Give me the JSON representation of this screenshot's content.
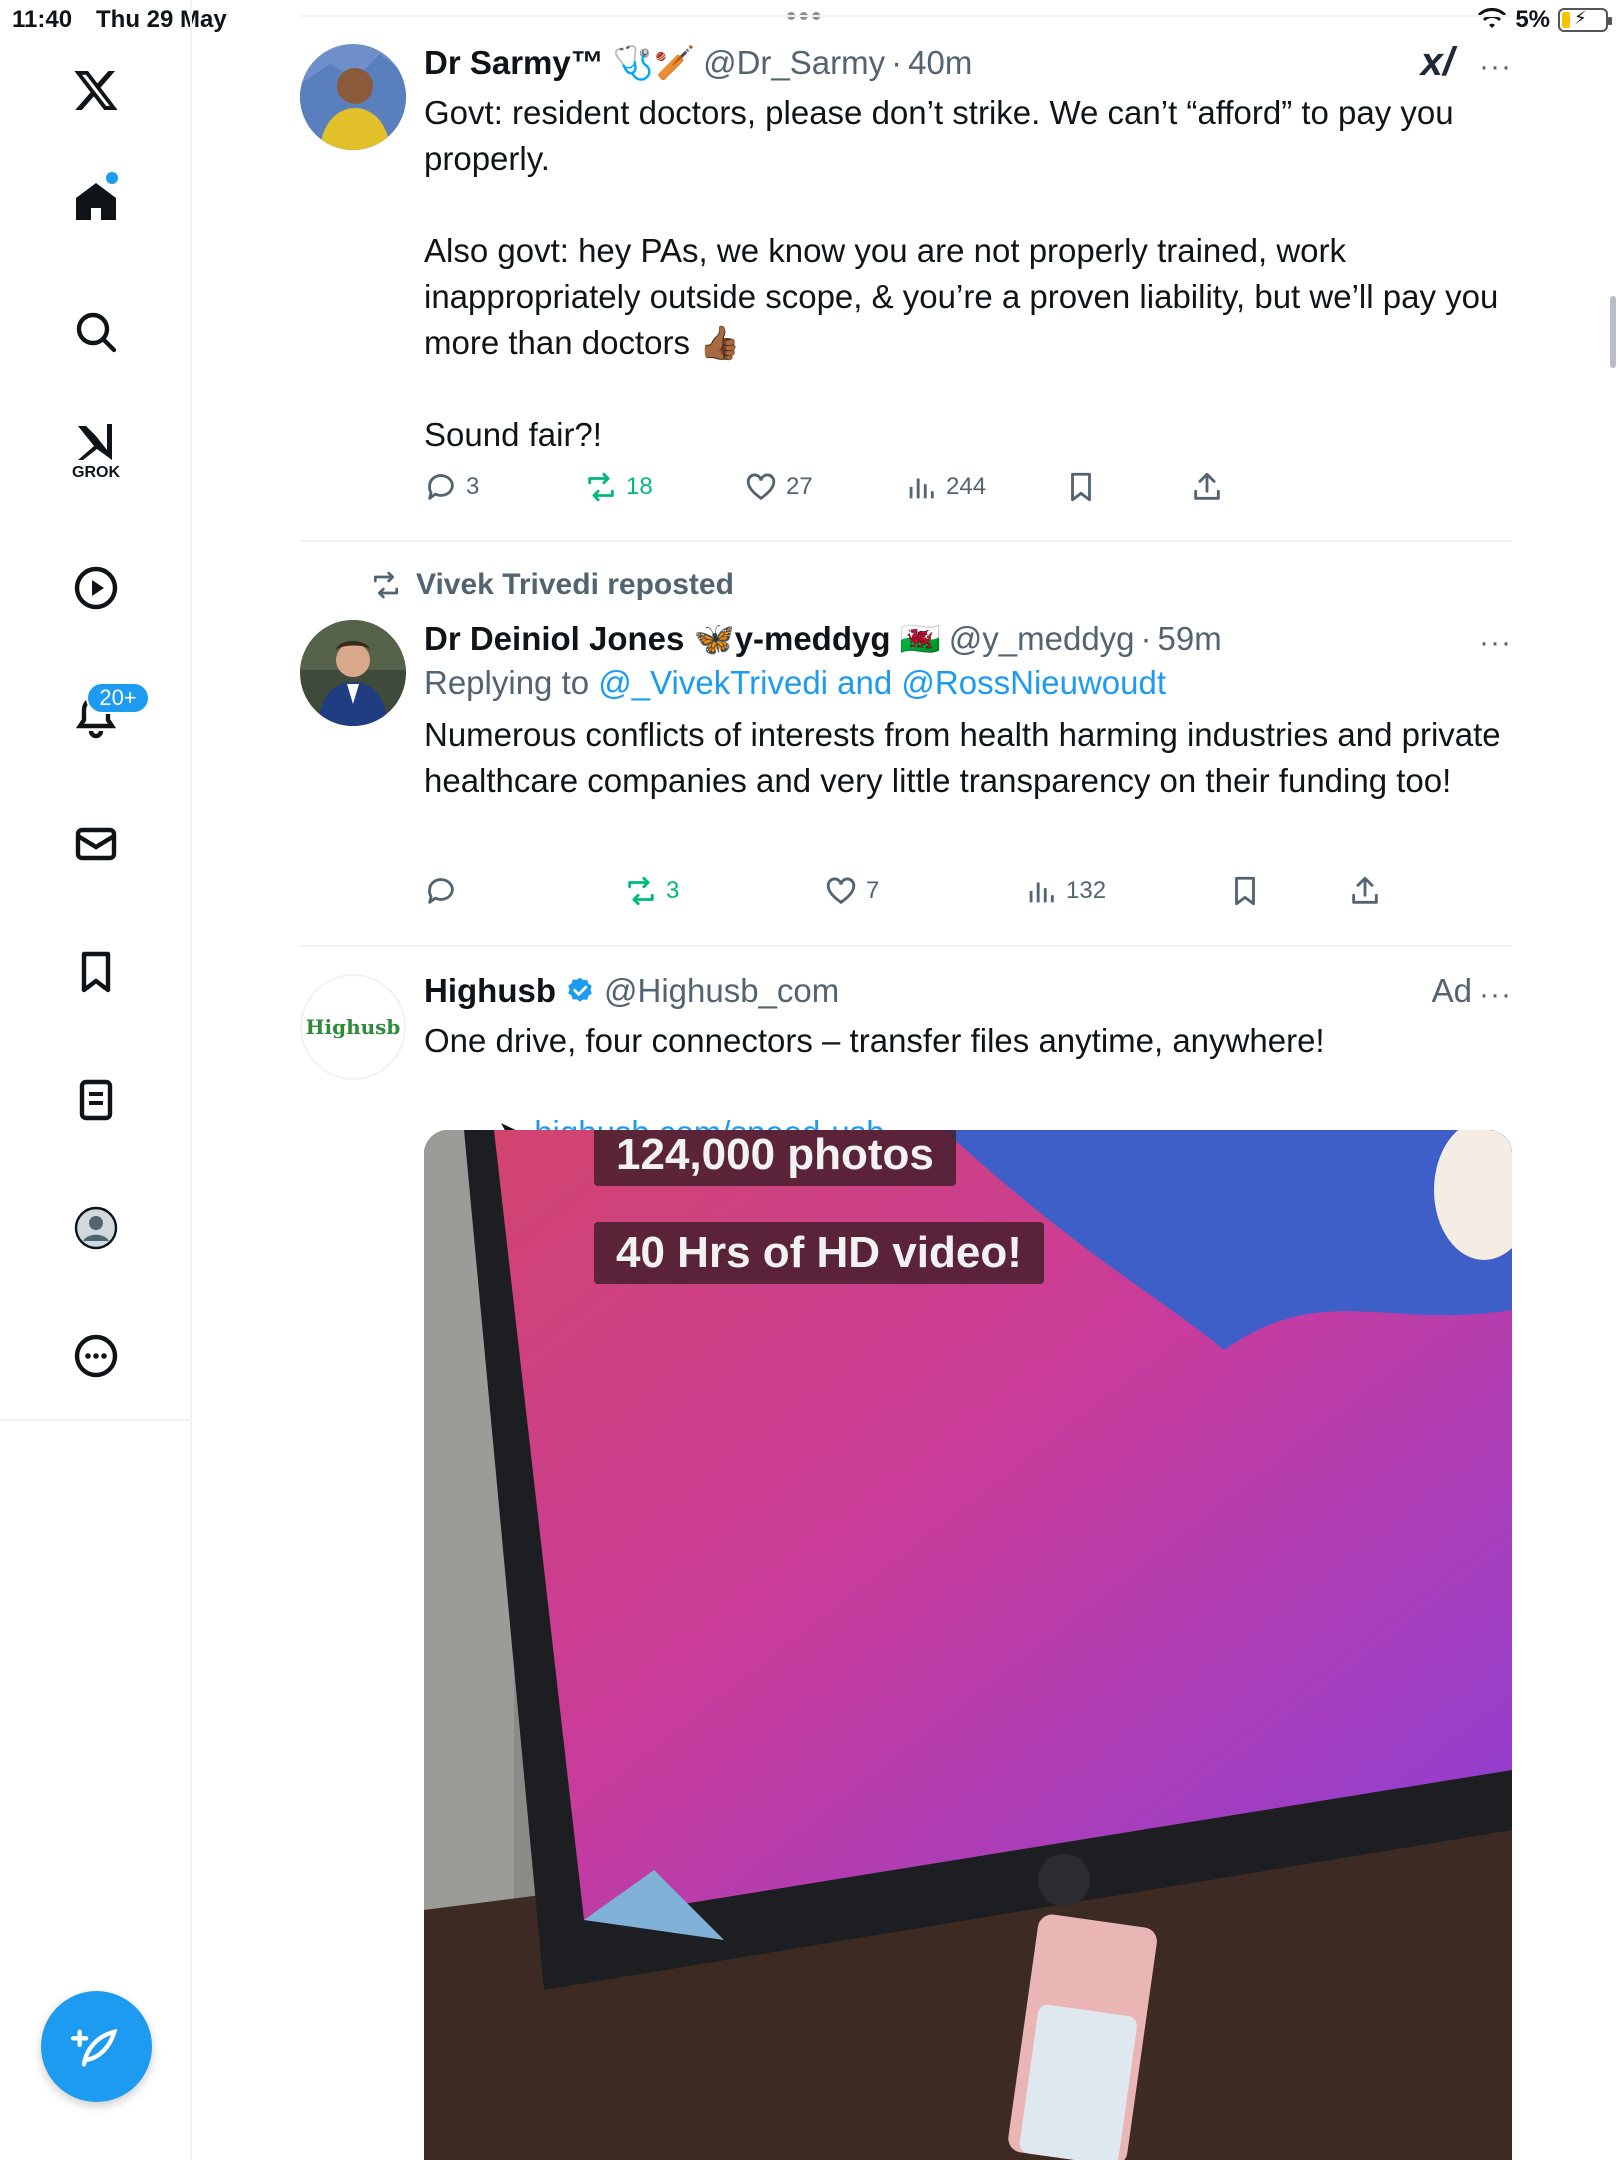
{
  "status_bar": {
    "time": "11:40",
    "date": "Thu 29 May",
    "battery_text": "5%"
  },
  "sidebar": {
    "notifications_badge": "20+",
    "grok_label": "GROK",
    "icons": [
      "x-logo-icon",
      "home-icon",
      "search-icon",
      "grok-icon",
      "video-icon",
      "bell-icon",
      "mail-icon",
      "bookmark-icon",
      "lists-icon",
      "profile-icon",
      "more-icon"
    ]
  },
  "tweets": [
    {
      "author_name": "Dr Sarmy™ 🩺🏏",
      "handle": "@Dr_Sarmy",
      "time": "40m",
      "text": "Govt: resident doctors, please don’t strike. We can’t “afford” to pay you properly.\n\nAlso govt: hey PAs, we know you are not properly trained, work inappropriately outside scope, & you’re a proven liability, but we’ll pay you more than doctors 👍🏾\n\nSound fair?!",
      "replies": "3",
      "reposts": "18",
      "likes": "27",
      "views": "244"
    },
    {
      "repost_banner": "Vivek Trivedi reposted",
      "author_name": "Dr Deiniol Jones 🦋y-meddyg 🏴󠁧󠁢󠁷󠁬󠁳󠁿",
      "handle": "@y_meddyg",
      "time": "59m",
      "reply_prefix": "Replying to ",
      "reply_user1": "@_VivekTrivedi",
      "reply_and": " and ",
      "reply_user2": "@RossNieuwoudt",
      "text": "Numerous conflicts of interests from health harming industries and private healthcare companies and very little transparency on their funding too!",
      "replies": "",
      "reposts": "3",
      "likes": "7",
      "views": "132"
    },
    {
      "author_name": "Highusb",
      "handle": "@Highusb_com",
      "ad_label": "Ad",
      "avatar_text": "Highusb",
      "text": "One drive, four connectors – transfer files anytime, anywhere!",
      "link_prefix": "➤ ",
      "link": "highusb.com/speed-usb",
      "media_overlay_1": "124,000 photos",
      "media_overlay_2": "40 Hrs of HD video!"
    }
  ],
  "colors": {
    "accent": "#1d9bf0",
    "repost_green": "#00ba7c",
    "secondary_text": "#536471"
  }
}
